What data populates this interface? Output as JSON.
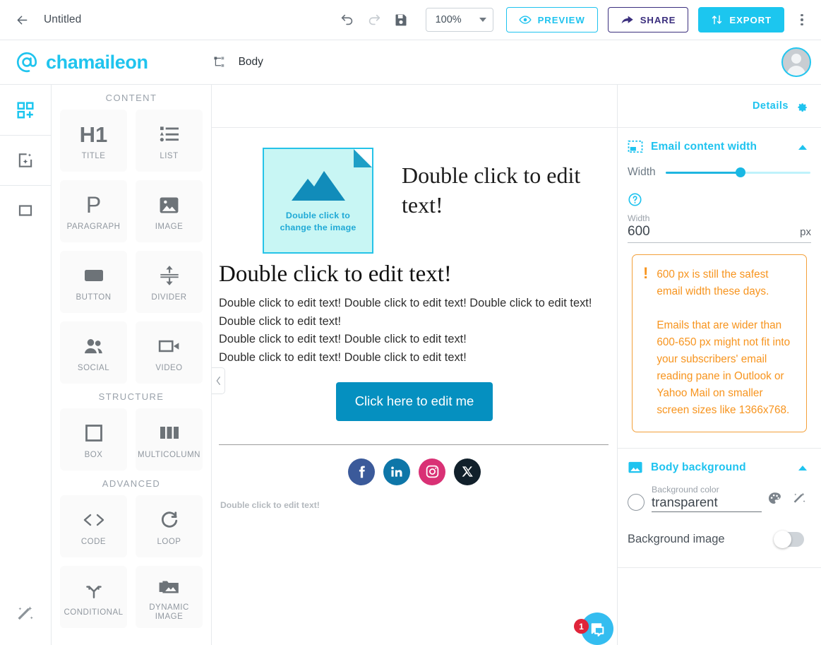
{
  "topbar": {
    "back_icon": "arrow-left-icon",
    "doc_title": "Untitled",
    "undo_icon": "undo-icon",
    "redo_icon": "redo-icon",
    "save_icon": "save-disk-icon",
    "zoom_value": "100%",
    "preview_label": "PREVIEW",
    "share_label": "SHARE",
    "export_label": "EXPORT",
    "menu_icon": "kebab-menu-icon"
  },
  "brandbar": {
    "logo_icon": "at-sign-icon",
    "brand_name": "chamaileon",
    "tree_icon": "hierarchy-tree-icon",
    "breadcrumb_label": "Body",
    "avatar_icon": "user-avatar"
  },
  "rail": {
    "items": [
      {
        "name": "blocks-icon",
        "active": true
      },
      {
        "name": "ai-template-icon",
        "active": false
      },
      {
        "name": "structure-icon",
        "active": false
      }
    ],
    "bottom_icon": "magic-wand-icon"
  },
  "blocks_panel": {
    "sections": [
      {
        "label": "CONTENT",
        "items": [
          {
            "label": "TITLE",
            "icon": "h1-icon"
          },
          {
            "label": "LIST",
            "icon": "list-icon"
          },
          {
            "label": "PARAGRAPH",
            "icon": "paragraph-icon"
          },
          {
            "label": "IMAGE",
            "icon": "image-icon"
          },
          {
            "label": "BUTTON",
            "icon": "button-icon"
          },
          {
            "label": "DIVIDER",
            "icon": "divider-icon"
          },
          {
            "label": "SOCIAL",
            "icon": "social-people-icon"
          },
          {
            "label": "VIDEO",
            "icon": "video-camera-icon"
          }
        ]
      },
      {
        "label": "STRUCTURE",
        "items": [
          {
            "label": "BOX",
            "icon": "box-square-icon"
          },
          {
            "label": "MULTICOLUMN",
            "icon": "multicolumn-icon"
          }
        ]
      },
      {
        "label": "ADVANCED",
        "items": [
          {
            "label": "CODE",
            "icon": "code-brackets-icon"
          },
          {
            "label": "LOOP",
            "icon": "loop-refresh-icon"
          },
          {
            "label": "CONDITIONAL",
            "icon": "branch-arrows-icon"
          },
          {
            "label": "DYNAMIC IMAGE",
            "icon": "dynamic-image-icon"
          }
        ]
      }
    ]
  },
  "canvas": {
    "collapse_icon": "chevron-left-icon",
    "image_placeholder": {
      "caption_line1": "Double click to",
      "caption_line2": "change the image",
      "icon": "mountain-image-icon"
    },
    "hero_title": "Double click to edit text!",
    "h1": "Double click to edit text!",
    "paragraph_lines": [
      "Double click to edit text! Double click to edit text! Double click to edit text! Double click to edit text!",
      "Double click to edit text! Double click to edit text!",
      "Double click to edit text! Double click to edit text!"
    ],
    "cta_label": "Click here to edit me",
    "social": [
      {
        "name": "facebook-icon",
        "glyph": "f"
      },
      {
        "name": "linkedin-icon",
        "glyph": "in"
      },
      {
        "name": "instagram-icon",
        "glyph": ""
      },
      {
        "name": "x-twitter-icon",
        "glyph": "X"
      }
    ],
    "footer_note": "Double click to edit text!"
  },
  "right_panel": {
    "details_label": "Details",
    "details_icon": "gear-icon",
    "email_content_width": {
      "icon": "content-width-icon",
      "title": "Email content width",
      "collapse_icon": "chevron-up-icon",
      "slider_label": "Width",
      "slider_percent": 52,
      "help_icon": "question-circle-icon",
      "field_label": "Width",
      "field_value": "600",
      "field_unit": "px"
    },
    "warning": {
      "icon": "exclamation-icon",
      "paragraphs": [
        "600 px is still the safest email width these days.",
        "Emails that are wider than 600-650 px might not fit into your subscribers' email reading pane in Outlook or Yahoo Mail on smaller screen sizes like 1366x768."
      ]
    },
    "body_background": {
      "icon": "image-fill-icon",
      "title": "Body background",
      "collapse_icon": "chevron-up-icon",
      "color_label": "Background color",
      "color_value": "transparent",
      "palette_icon": "color-palette-icon",
      "magic_icon": "magic-wand-icon",
      "bg_image_label": "Background image",
      "bg_image_enabled": false
    }
  },
  "chat": {
    "icon": "chat-bubble-icon",
    "badge_count": "1"
  },
  "colors": {
    "accent": "#1cc6ef",
    "brand": "#20c4ee",
    "warning": "#f7941e",
    "share_purple": "#3b2f7e",
    "cta_blue": "#0590c0"
  }
}
